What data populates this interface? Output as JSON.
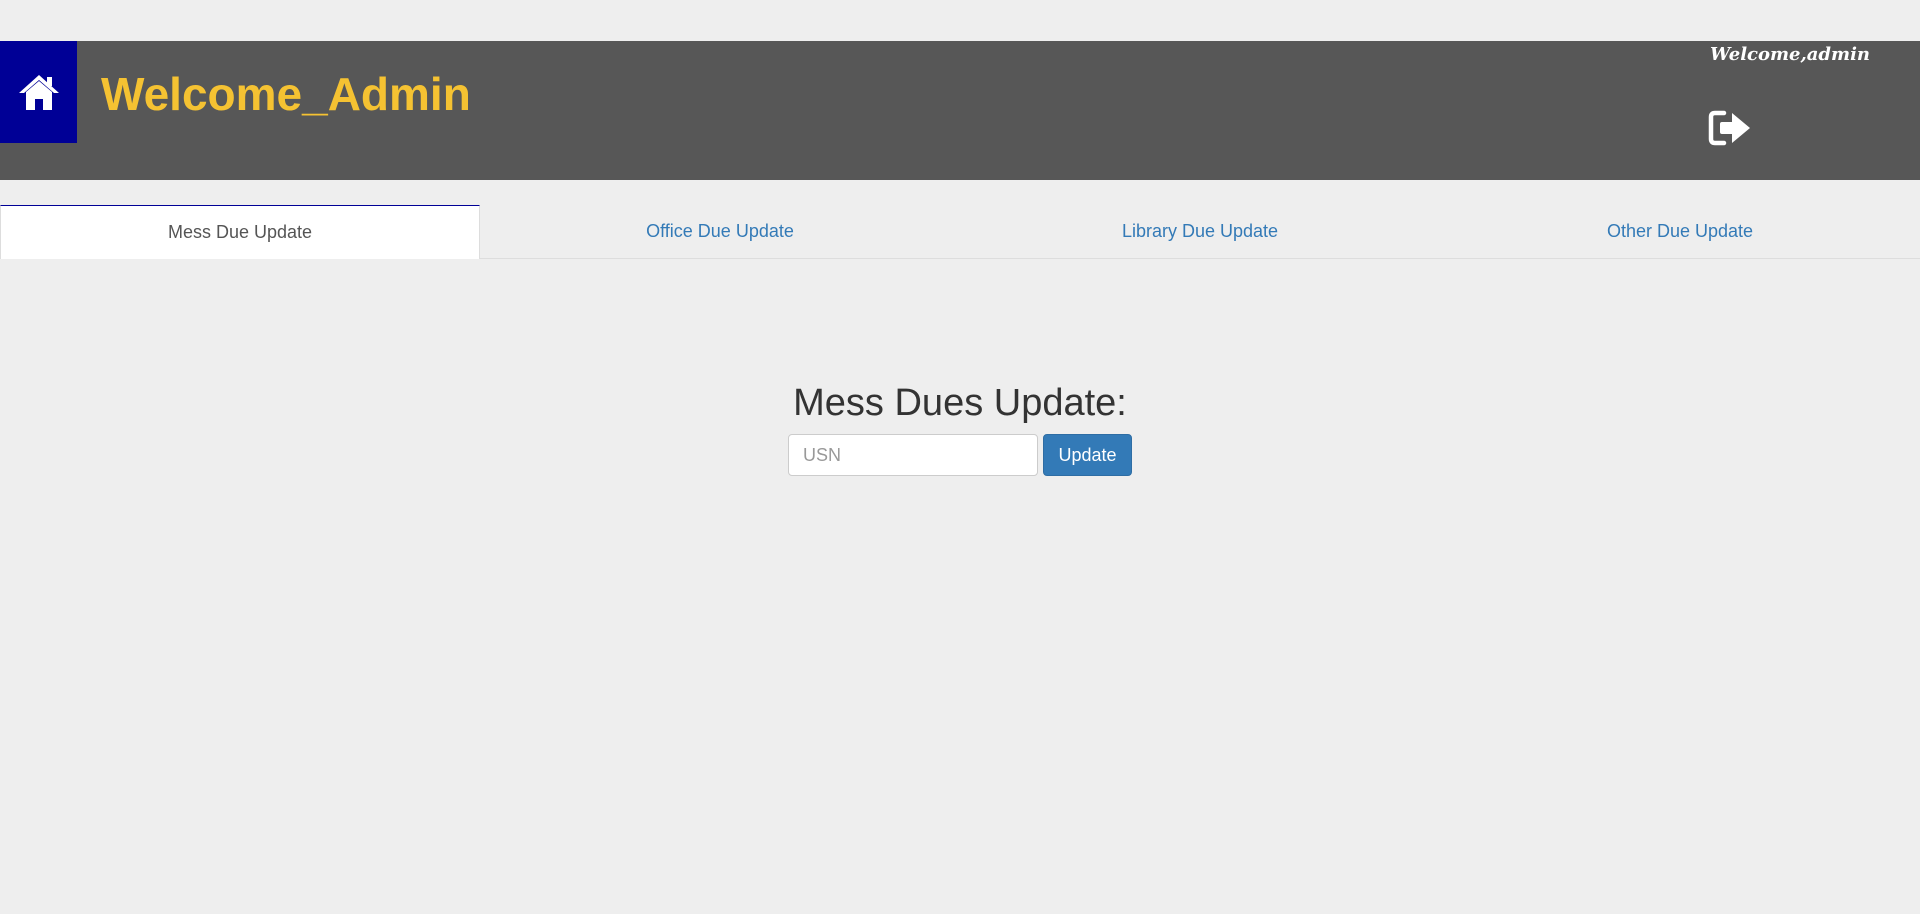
{
  "header": {
    "title": "Welcome_Admin",
    "welcome_user": "Welcome,admin",
    "home_icon": "home-icon",
    "logout_icon": "sign-out-icon",
    "colors": {
      "bar": "#575757",
      "home_box": "#000096",
      "title": "#f5c232"
    }
  },
  "tabs": [
    {
      "label": "Mess Due Update",
      "active": true
    },
    {
      "label": "Office Due Update",
      "active": false
    },
    {
      "label": "Library Due Update",
      "active": false
    },
    {
      "label": "Other Due Update",
      "active": false
    }
  ],
  "form": {
    "heading": "Mess Dues Update:",
    "usn_placeholder": "USN",
    "usn_value": "",
    "submit_label": "Update",
    "button_color": "#337ab7"
  }
}
